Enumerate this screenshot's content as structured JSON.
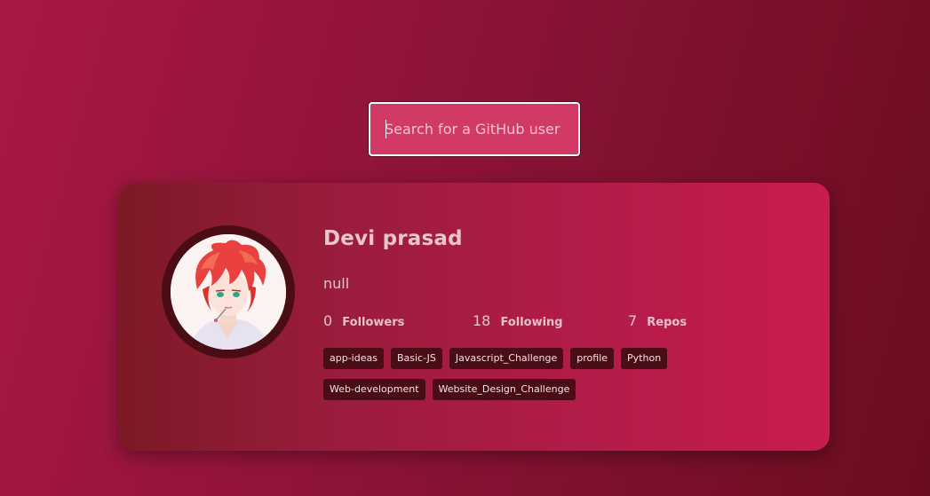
{
  "search": {
    "placeholder": "Search for a GitHub user"
  },
  "profile": {
    "name": "Devi prasad",
    "bio": "null",
    "stats": [
      {
        "value": "0",
        "label": "Followers"
      },
      {
        "value": "18",
        "label": "Following"
      },
      {
        "value": "7",
        "label": "Repos"
      }
    ],
    "repos": [
      "app-ideas",
      "Basic-JS",
      "Javascript_Challenge",
      "profile",
      "Python",
      "Web-development",
      "Website_Design_Challenge"
    ]
  },
  "colors": {
    "background": "#8d1338",
    "search_fill": "#d23a66",
    "card_start": "#7c1a26",
    "card_end": "#c81c4e",
    "chip": "#4a0d16"
  }
}
